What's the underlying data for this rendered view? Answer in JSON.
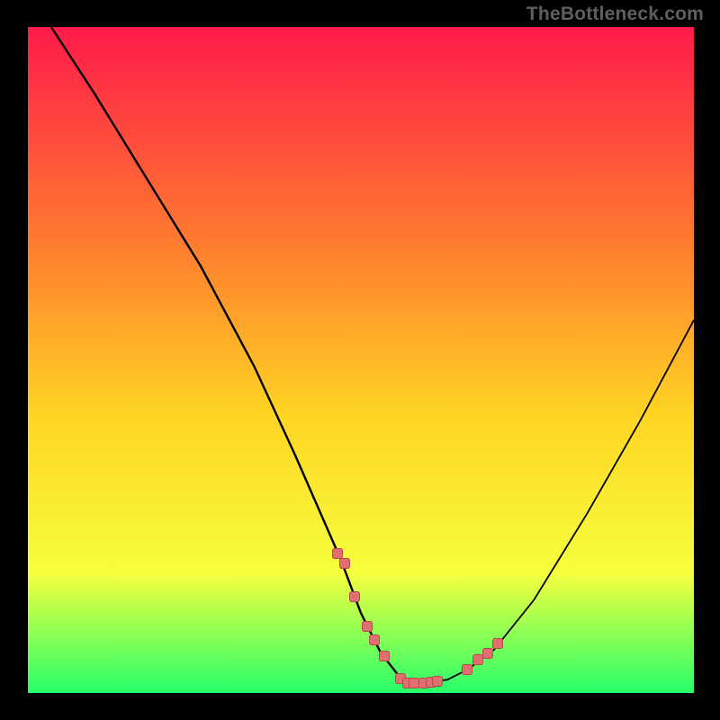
{
  "watermark": "TheBottleneck.com",
  "colors": {
    "page_bg": "#000000",
    "watermark": "#5f5f5f",
    "gradient_top": "#ff1a4a",
    "gradient_upper_mid": "#ff7a2f",
    "gradient_mid": "#ffd423",
    "gradient_lower_mid": "#f6ff3e",
    "gradient_bottom": "#27ff6a",
    "curve": "#000000",
    "point_fill": "#e07070",
    "point_stroke": "#b84848"
  },
  "chart_data": {
    "type": "line",
    "title": "",
    "xlabel": "",
    "ylabel": "",
    "xlim": [
      0,
      100
    ],
    "ylim": [
      0,
      100
    ],
    "grid": false,
    "legend": false,
    "series": [
      {
        "name": "curve-left-branch",
        "x": [
          3.5,
          10,
          18,
          26,
          34,
          40,
          47,
          50,
          53,
          56,
          57
        ],
        "y": [
          100,
          90,
          77,
          64,
          49,
          36,
          20,
          12,
          6,
          2.2,
          1.5
        ]
      },
      {
        "name": "curve-right-branch",
        "x": [
          57,
          58,
          60,
          63,
          66,
          70,
          76,
          84,
          92,
          100
        ],
        "y": [
          1.5,
          1.5,
          1.6,
          2.0,
          3.5,
          6.5,
          14,
          27,
          41,
          56
        ]
      },
      {
        "name": "data-points",
        "x": [
          46.5,
          47.5,
          49,
          51,
          52,
          53.5,
          56,
          57,
          58,
          59.5,
          60.5,
          61.5,
          66,
          67.5,
          69,
          70.5
        ],
        "y": [
          21,
          19.5,
          14.5,
          10,
          8,
          5.5,
          2.2,
          1.5,
          1.5,
          1.5,
          1.6,
          1.8,
          3.5,
          5,
          6,
          7.5
        ]
      }
    ]
  }
}
